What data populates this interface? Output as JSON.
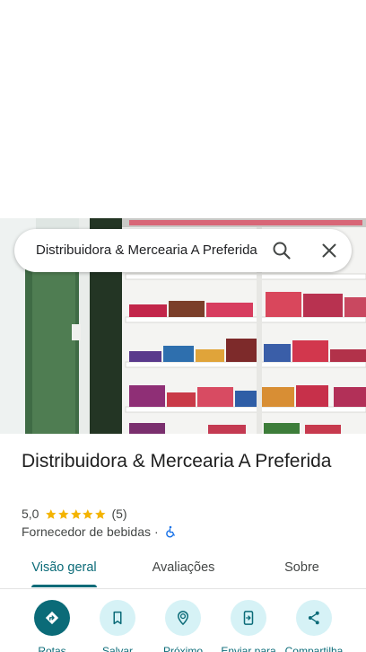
{
  "search": {
    "query": "Distribuidora & Mercearia A Preferida"
  },
  "place": {
    "name": "Distribuidora & Mercearia A Preferida",
    "rating": "5,0",
    "stars": 5,
    "review_count": "(5)",
    "category": "Fornecedor de bebidas",
    "separator": "·"
  },
  "tabs": [
    {
      "label": "Visão geral"
    },
    {
      "label": "Avaliações"
    },
    {
      "label": "Sobre"
    }
  ],
  "actions": [
    {
      "label": "Rotas",
      "icon": "directions-icon"
    },
    {
      "label": "Salvar",
      "icon": "bookmark-icon"
    },
    {
      "label": "Próximo",
      "icon": "nearby-icon"
    },
    {
      "label": "Enviar para",
      "icon": "send-to-phone-icon"
    },
    {
      "label": "Compartilha",
      "icon": "share-icon"
    }
  ],
  "colors": {
    "accent": "#0b6b78",
    "accent_light": "#d6f2f6",
    "star": "#f4b400",
    "accessibility": "#1a73e8"
  }
}
